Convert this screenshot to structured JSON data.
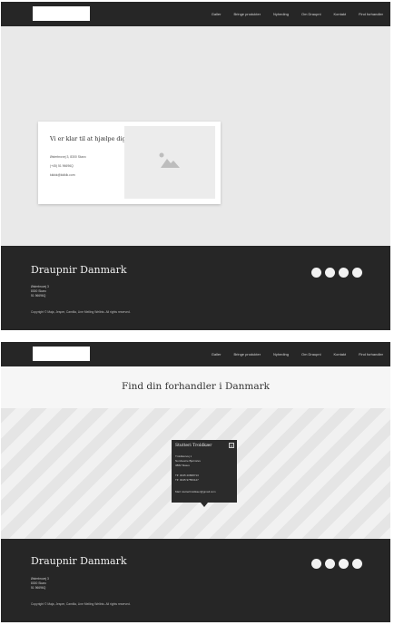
{
  "nav": {
    "items": [
      "Galler",
      "Bringe produkter",
      "Nyheding",
      "Om Draupni",
      "Kontakt",
      "Find forhandler"
    ]
  },
  "contact_card": {
    "title": "Vi er klar til at hjælpe dig",
    "address": "Østerbrovej 3, 8300 Skaro",
    "phone": "(+45) 51 96696Q",
    "email": "kkkkk@kklklk.com"
  },
  "footer": {
    "title": "Draupnir Danmark",
    "address_lines": [
      "Østerbrovej 3",
      "8300 Skaro",
      "51 96696Q"
    ],
    "copyright": "Copyright © Maja, Jesper, Camilla, Line Meiling Wellnis. All rights reserved."
  },
  "page2": {
    "heading": "Find din forhandler i Danmark",
    "popup": {
      "title": "Stutteri Troldkær",
      "close": "×",
      "lines": [
        "Troldkærvej 1",
        "Nordvestre Bjørnslev",
        "3882 Skaus",
        "Tlf: 0045 20808713",
        "Tlf: 0045 97553127",
        "Mail: stutteritroldkaer@gmail.com"
      ]
    },
    "nav_items": [
      "Galler",
      "Bringe produkter",
      "Nyheding",
      "Om Draupni",
      "Kontakt",
      "Find forhandler"
    ],
    "footer_title": "Draupnir Danmark",
    "footer_address_lines": [
      "Østerbrovej 3",
      "8300 Skaro",
      "51 96696Q"
    ],
    "footer_copyright": "Copyright © Maja, Jesper, Camilla, Line Meiling Wellnis. All rights reserved."
  },
  "colors": {
    "dark": "#262626",
    "hero_bg": "#e9e9e9",
    "text_light": "#eeeeee"
  },
  "icons": [
    "image-placeholder-icon",
    "social-icon",
    "social-icon",
    "social-icon",
    "social-icon"
  ]
}
